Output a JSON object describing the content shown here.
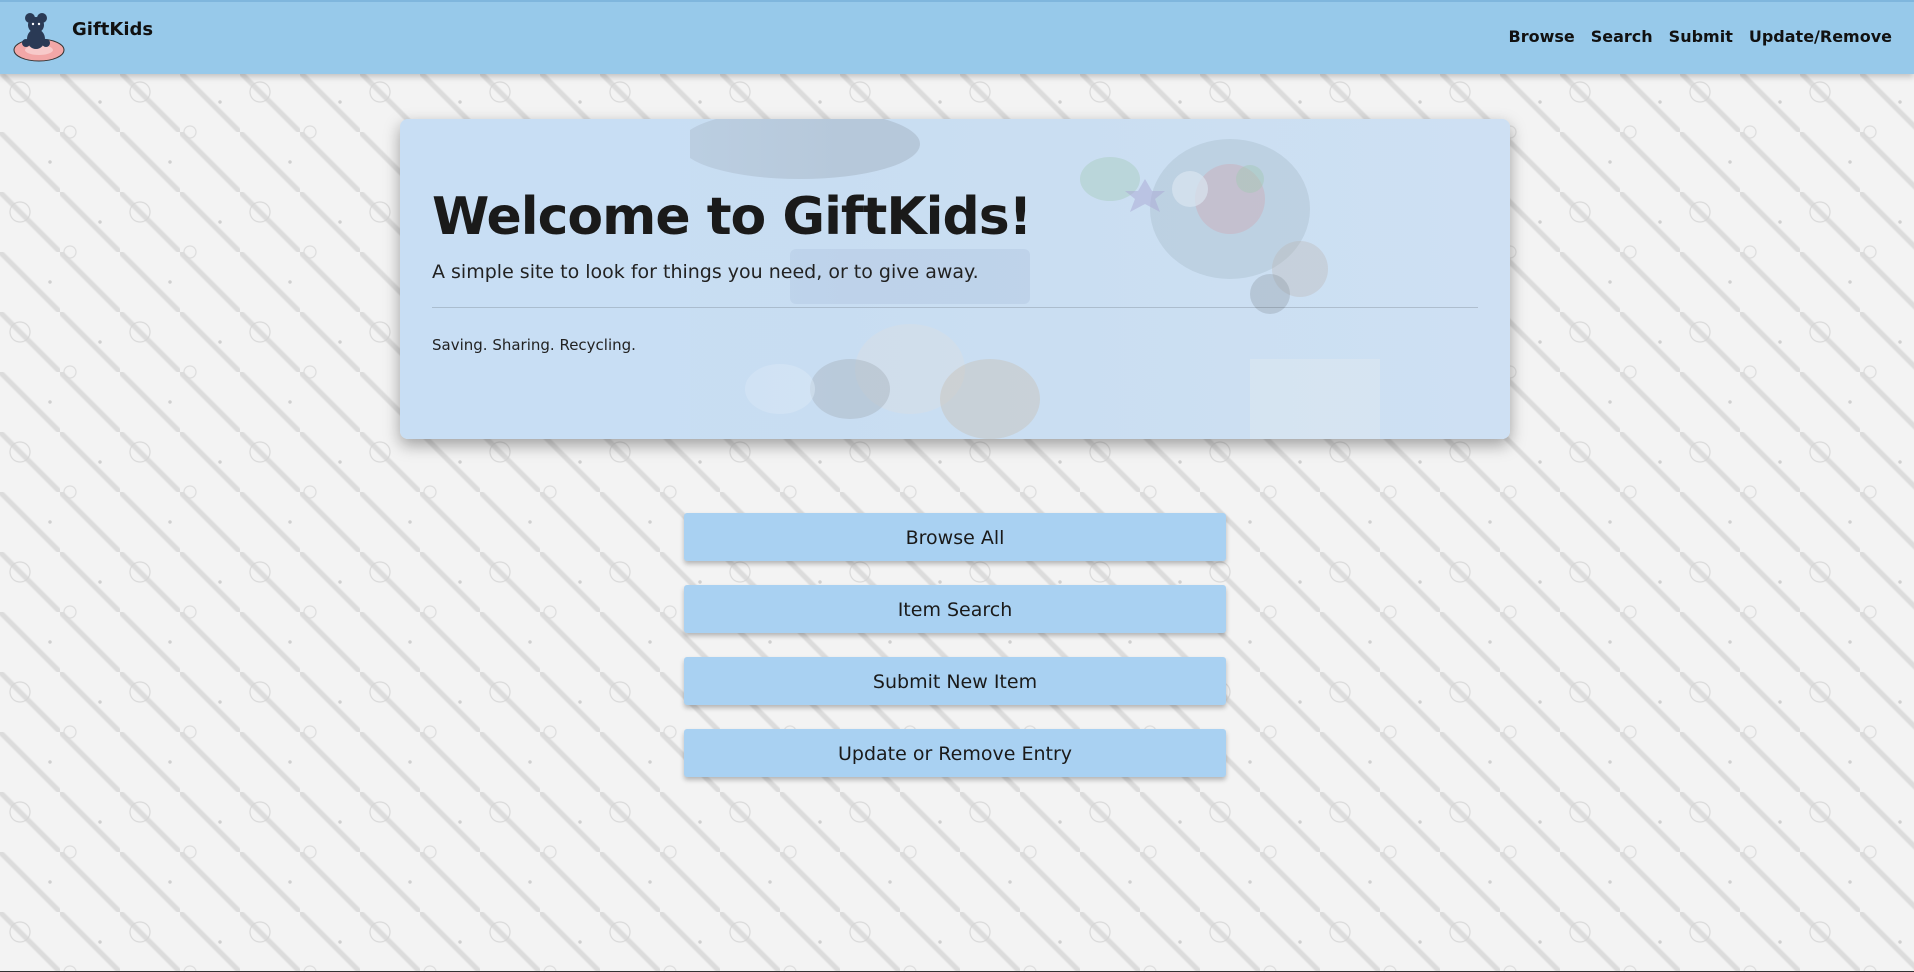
{
  "app": {
    "name": "GiftKids",
    "logo_icon": "teddy-bear-logo"
  },
  "nav": {
    "items": [
      {
        "label": "Browse"
      },
      {
        "label": "Search"
      },
      {
        "label": "Submit"
      },
      {
        "label": "Update/Remove"
      }
    ]
  },
  "hero": {
    "title": "Welcome to GiftKids!",
    "subtitle": "A simple site to look for things you need, or to give away.",
    "tagline": "Saving. Sharing. Recycling."
  },
  "actions": {
    "browse_all": "Browse All",
    "item_search": "Item Search",
    "submit_new": "Submit New Item",
    "update_remove": "Update or Remove Entry"
  },
  "colors": {
    "header": "#97c9ea",
    "button": "#a9d1f2",
    "hero": "#c5ddf4"
  }
}
